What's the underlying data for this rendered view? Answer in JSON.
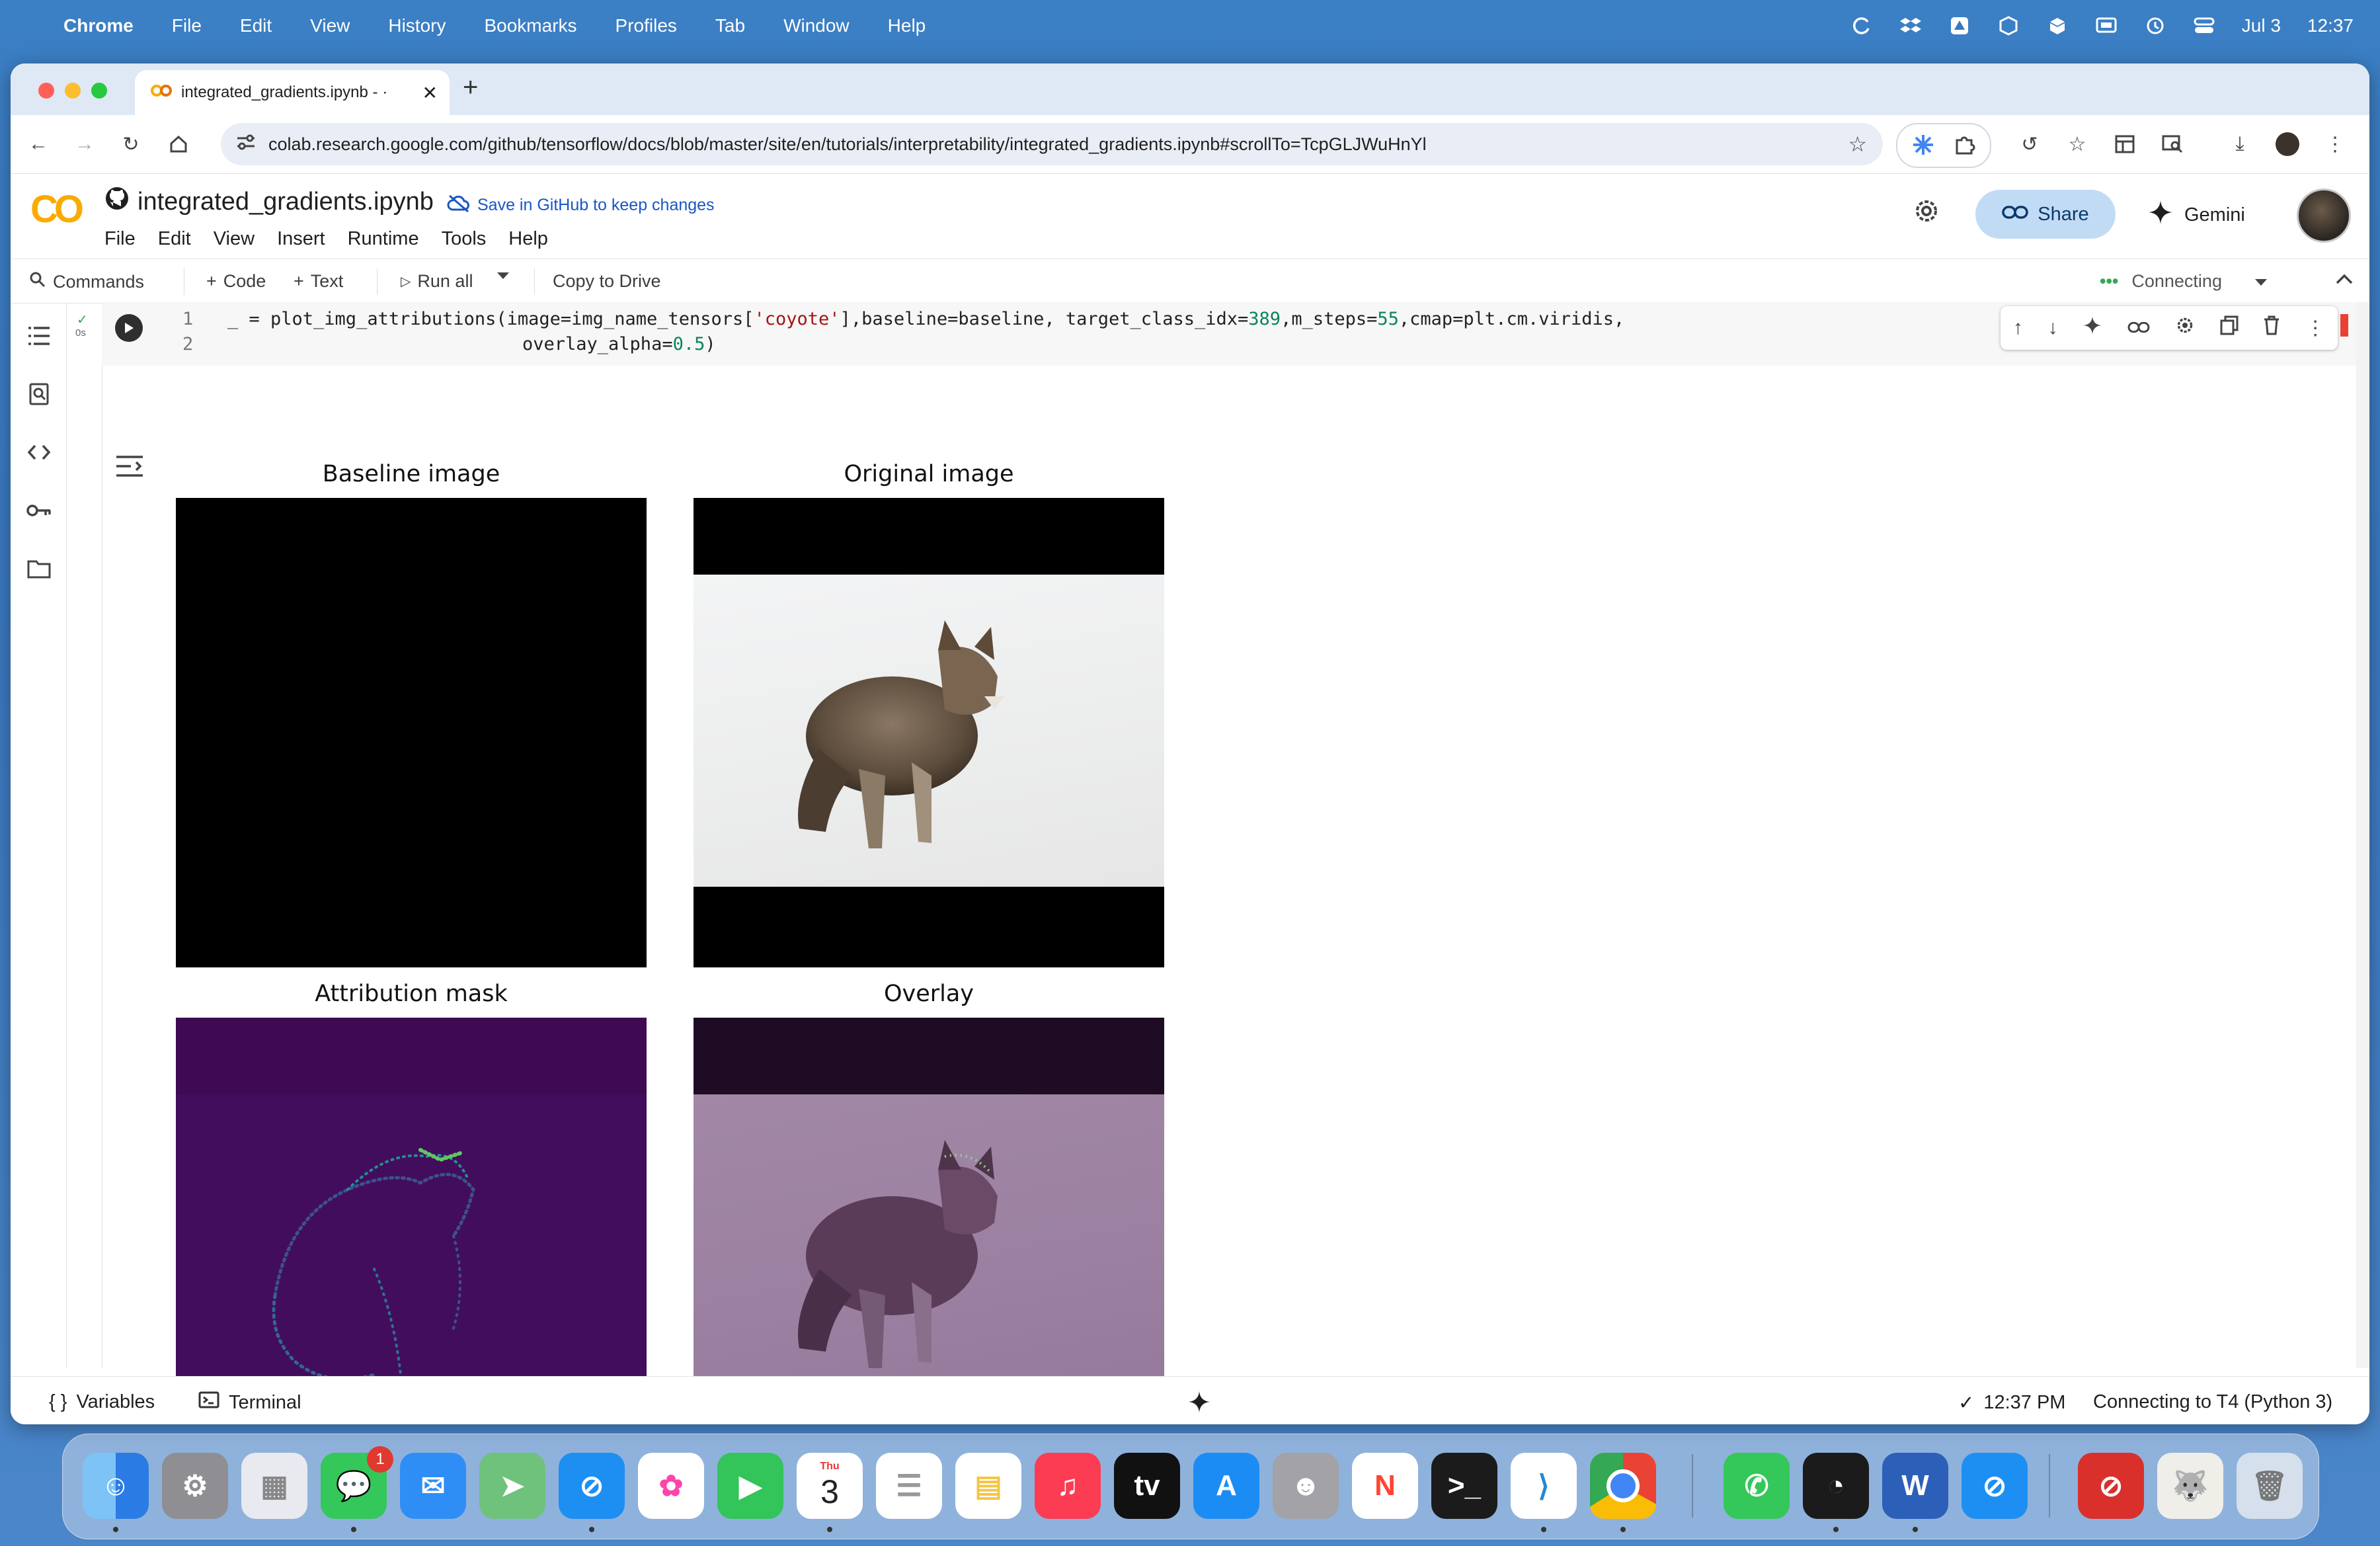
{
  "menubar": {
    "app": "Chrome",
    "items": [
      "File",
      "Edit",
      "View",
      "History",
      "Bookmarks",
      "Profiles",
      "Tab",
      "Window",
      "Help"
    ],
    "date": "Jul 3",
    "time": "12:37"
  },
  "browser": {
    "tab_title": "integrated_gradients.ipynb - ·",
    "url": "colab.research.google.com/github/tensorflow/docs/blob/master/site/en/tutorials/interpretability/integrated_gradients.ipynb#scrollTo=TcpGLJWuHnYl"
  },
  "colab": {
    "logo": "CO",
    "notebook_title": "integrated_gradients.ipynb",
    "save_link": "Save in GitHub to keep changes",
    "menus": [
      "File",
      "Edit",
      "View",
      "Insert",
      "Runtime",
      "Tools",
      "Help"
    ],
    "share_label": "Share",
    "gemini_label": "Gemini",
    "commands_label": "Commands",
    "add_code_label": "Code",
    "add_text_label": "Text",
    "run_all_label": "Run all",
    "copy_to_drive_label": "Copy to Drive",
    "connecting_label": "Connecting",
    "cell_exec_time": "0s",
    "code_line_numbers": [
      "1",
      "2"
    ],
    "code": {
      "l1_a": "_ = plot_img_attributions(image=img_name_tensors[",
      "l1_str": "'coyote'",
      "l1_b": "],baseline=baseline, target_class_idx=",
      "l1_n1": "389",
      "l1_c": ",m_steps=",
      "l1_n2": "55",
      "l1_d": ",cmap=plt.cm.viridis,",
      "l2_a": "overlay_alpha=",
      "l2_n": "0.5",
      "l2_b": ")"
    },
    "plots": {
      "baseline_title": "Baseline image",
      "original_title": "Original image",
      "mask_title": "Attribution mask",
      "overlay_title": "Overlay"
    },
    "status": {
      "variables_label": "Variables",
      "terminal_label": "Terminal",
      "time": "12:37 PM",
      "runtime": "Connecting to T4 (Python 3)"
    }
  },
  "dock": {
    "messages_badge": "1",
    "calendar_month": "Thu",
    "calendar_day": "3"
  },
  "colors": {
    "accent_blue": "#1a73e8",
    "share_bg": "#c2dbf5",
    "colab_orange": "#f9ab00",
    "viridis_dark": "#440154"
  }
}
